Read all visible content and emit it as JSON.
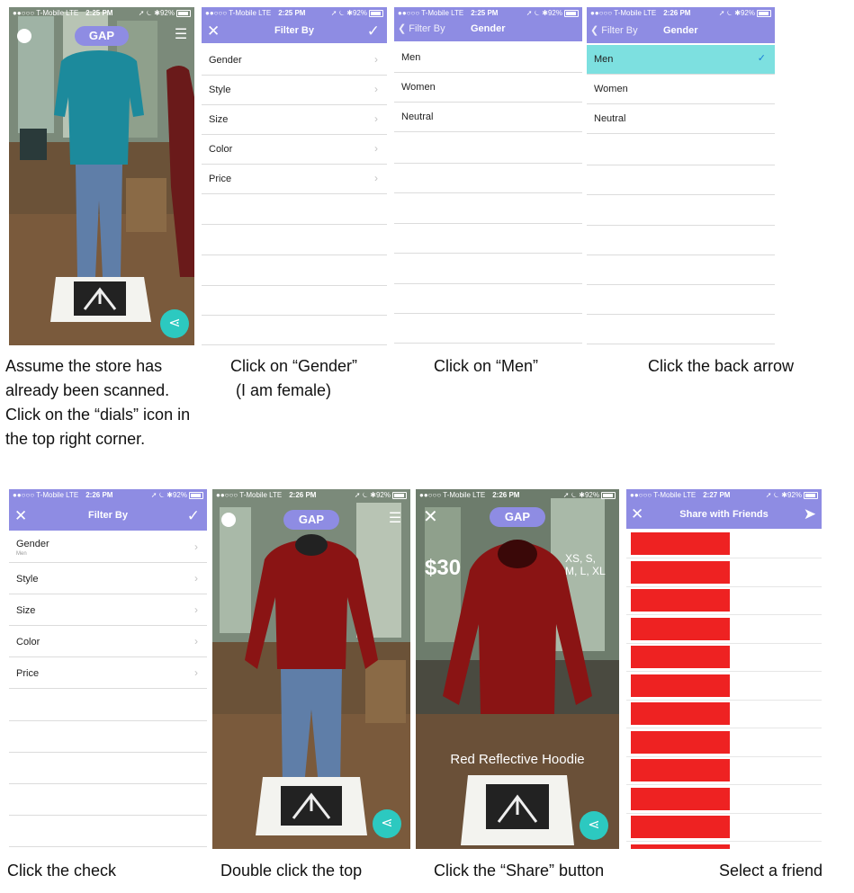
{
  "status": {
    "carrier": "●●○○○ T-Mobile",
    "network": "LTE",
    "battery": "92%"
  },
  "times": {
    "p1": "2:25 PM",
    "p2": "2:25 PM",
    "p3": "2:25 PM",
    "p4": "2:26 PM",
    "p5": "2:26 PM",
    "p6": "2:26 PM",
    "p7": "2:26 PM",
    "p8": "2:27 PM"
  },
  "colors": {
    "nav": "#8e8ce3",
    "share": "#2cc9c0",
    "selected": "#7de0e0",
    "friend": "#ee2222"
  },
  "filter": {
    "title": "Filter By",
    "items": [
      "Gender",
      "Style",
      "Size",
      "Color",
      "Price"
    ],
    "gender_sub": "Men"
  },
  "gender": {
    "title": "Gender",
    "back": "Filter By",
    "options": [
      "Men",
      "Women",
      "Neutral"
    ]
  },
  "store": {
    "brand": "GAP"
  },
  "product": {
    "price": "$30",
    "sizes_line1": "XS, S,",
    "sizes_line2": "M, L, XL",
    "name": "Red Reflective Hoodie"
  },
  "share": {
    "title": "Share with Friends"
  },
  "captions": {
    "c1_l1": "Assume the store has",
    "c1_l2": "already been scanned.",
    "c1_l3": "Click on the “dials” icon in",
    "c1_l4": "the top right corner.",
    "c2_l1": "Click on “Gender”",
    "c2_l2": "(I am female)",
    "c3": "Click on “Men”",
    "c4": "Click the back arrow",
    "c5": "Click the check",
    "c6": "Double click the top",
    "c7": "Click the “Share” button",
    "c8": "Select a friend"
  }
}
